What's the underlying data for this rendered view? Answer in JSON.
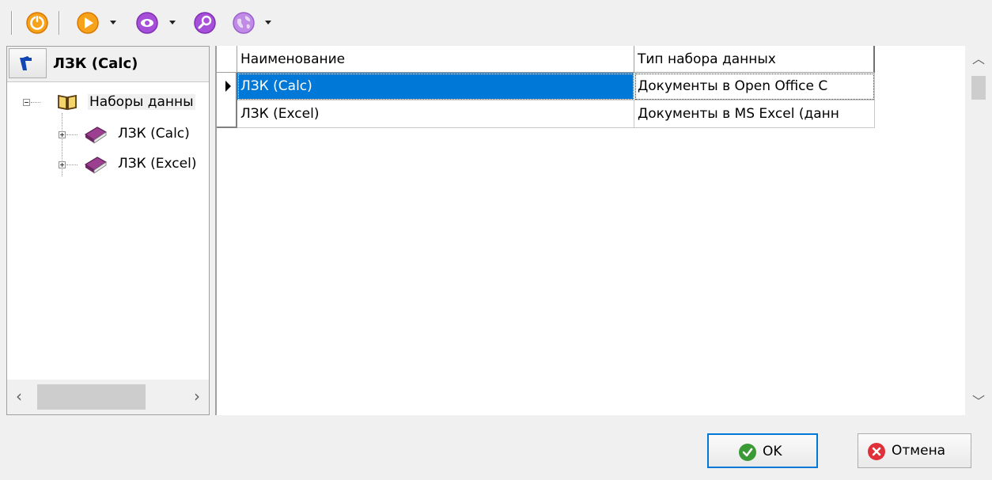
{
  "toolbar": {
    "buttons": [
      {
        "icon": "refresh-icon",
        "color": "#f28c00"
      },
      {
        "icon": "run-icon",
        "color": "#f28c00"
      },
      {
        "icon": "view-icon",
        "color": "#9b3fd6"
      },
      {
        "icon": "search-icon",
        "color": "#9b3fd6"
      },
      {
        "icon": "globe-icon",
        "color": "#9b3fd6"
      }
    ]
  },
  "left_pane": {
    "title": "ЛЗК (Calc)",
    "tree": {
      "root": {
        "label": "Наборы данны",
        "icon": "open-book-icon"
      },
      "children": [
        {
          "label": "ЛЗК (Calc)",
          "icon": "book-icon"
        },
        {
          "label": "ЛЗК (Excel)",
          "icon": "book-icon"
        }
      ]
    }
  },
  "grid": {
    "columns": [
      "Наименование",
      "Тип набора данных"
    ],
    "rows": [
      {
        "name": "ЛЗК (Calc)",
        "type": "Документы в Open Office C",
        "selected": true
      },
      {
        "name": "ЛЗК (Excel)",
        "type": "Документы в MS Excel (данн",
        "selected": false
      }
    ]
  },
  "buttons": {
    "ok_label": "OK",
    "cancel_label": "Отмена"
  },
  "colors": {
    "selection": "#0078d7",
    "ok_green": "#3a9a35",
    "cancel_red": "#e0313a",
    "book_purple": "#8e3a84"
  }
}
